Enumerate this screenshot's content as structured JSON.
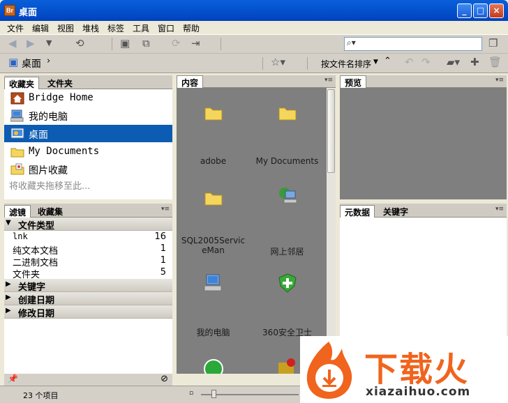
{
  "window": {
    "app_icon_text": "Br",
    "title": "桌面",
    "minimize": "_",
    "maximize": "□",
    "close": "×"
  },
  "menu": [
    "文件",
    "编辑",
    "视图",
    "堆栈",
    "标签",
    "工具",
    "窗口",
    "帮助"
  ],
  "toolbar": {
    "search_placeholder": "",
    "breadcrumb": "桌面",
    "sort_label": "按文件名排序"
  },
  "favorites": {
    "tabs": [
      "收藏夹",
      "文件夹"
    ],
    "items": [
      {
        "label": "Bridge Home",
        "icon": "bridge-home-icon",
        "selected": false
      },
      {
        "label": "我的电脑",
        "icon": "my-computer-icon",
        "selected": false
      },
      {
        "label": "桌面",
        "icon": "desktop-icon",
        "selected": true
      },
      {
        "label": "My Documents",
        "icon": "folder-icon",
        "selected": false
      },
      {
        "label": "图片收藏",
        "icon": "pictures-folder-icon",
        "selected": false
      }
    ],
    "hint": "将收藏夹拖移至此..."
  },
  "filter": {
    "tabs": [
      "滤镜",
      "收藏集"
    ],
    "file_type_header": "文件类型",
    "file_types": [
      {
        "label": "lnk",
        "count": "16"
      },
      {
        "label": "纯文本文档",
        "count": "1"
      },
      {
        "label": "二进制文档",
        "count": "1"
      },
      {
        "label": "文件夹",
        "count": "5"
      }
    ],
    "collapsed": [
      "关键字",
      "创建日期",
      "修改日期"
    ]
  },
  "content": {
    "tab": "内容",
    "items": [
      {
        "label": "adobe",
        "icon": "folder-icon"
      },
      {
        "label": "My Documents",
        "icon": "folder-icon"
      },
      {
        "label": "SQL2005ServiceMan",
        "icon": "folder-icon"
      },
      {
        "label": "网上邻居",
        "icon": "network-icon"
      },
      {
        "label": "我的电脑",
        "icon": "my-computer-icon"
      },
      {
        "label": "360安全卫士",
        "icon": "shield-icon"
      }
    ]
  },
  "preview": {
    "tab": "预览"
  },
  "metadata": {
    "tabs": [
      "元数据",
      "关键字"
    ]
  },
  "status": {
    "item_count": "23 个项目"
  },
  "watermark": {
    "brand": "下载火",
    "url": "xiazaihuo.com"
  },
  "colors": {
    "selection": "#0b5cb2",
    "titlebar": "#0454d0",
    "content_bg": "#7f7f7f",
    "logo_orange": "#f0641e"
  }
}
